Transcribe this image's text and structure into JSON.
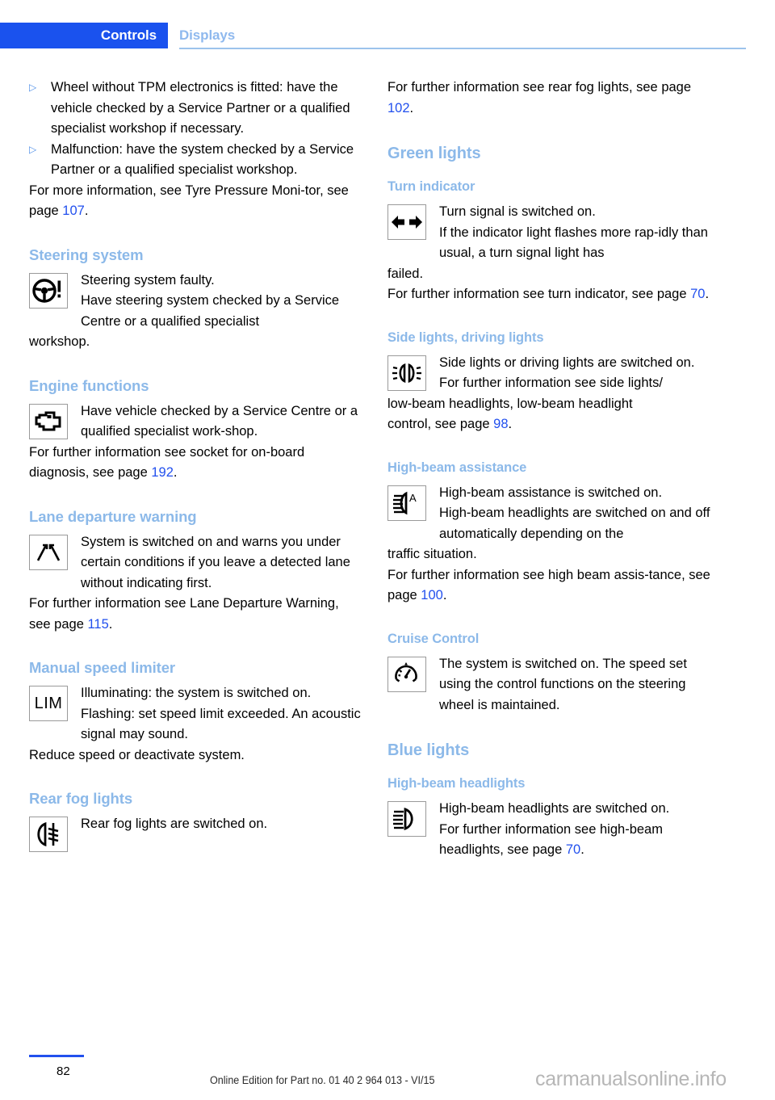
{
  "header": {
    "tab_active": "Controls",
    "tab_inactive": "Displays"
  },
  "colors": {
    "accent_blue": "#1A52EE",
    "heading_blue": "#8CB9E9",
    "link_blue": "#2250EE",
    "tab_inactive_blue": "#8FB9EE"
  },
  "left_column": {
    "bullets": [
      {
        "marker": "▷",
        "text": "Wheel without TPM electronics is fitted: have the vehicle checked by a Service Partner or a qualified specialist workshop if necessary."
      },
      {
        "marker": "▷",
        "text": "Malfunction: have the system checked by a Service Partner or a qualified specialist workshop."
      }
    ],
    "intro_para_prefix": "For more information, see Tyre Pressure Moni‐tor, see page ",
    "intro_para_link": "107",
    "intro_para_suffix": ".",
    "sections": [
      {
        "heading": "Steering system",
        "icon": "steering-wheel-warning-icon",
        "indented_lines": [
          "Steering system faulty.",
          "Have steering system checked by a Service Centre or a qualified specialist"
        ],
        "full_lines": [
          "workshop."
        ],
        "ref_prefix": "",
        "ref_link": "",
        "ref_suffix": ""
      },
      {
        "heading": "Engine functions",
        "icon": "engine-check-icon",
        "indented_lines": [
          "Have vehicle checked by a Service Centre or a qualified specialist work‐shop."
        ],
        "full_lines": [],
        "ref_prefix": "For further information see socket for on‐board diagnosis, see page ",
        "ref_link": "192",
        "ref_suffix": "."
      },
      {
        "heading": "Lane departure warning",
        "icon": "lane-departure-icon",
        "indented_lines": [
          "System is switched on and warns you under certain conditions if you leave a detected lane without indicating first."
        ],
        "full_lines": [],
        "ref_prefix": "For further information see Lane Departure Warning, see page ",
        "ref_link": "115",
        "ref_suffix": "."
      },
      {
        "heading": "Manual speed limiter",
        "icon": "lim-icon",
        "icon_label": "LIM",
        "indented_lines": [
          "Illuminating: the system is switched on.",
          "Flashing: set speed limit exceeded. An acoustic signal may sound."
        ],
        "full_lines": [
          "Reduce speed or deactivate system."
        ],
        "ref_prefix": "",
        "ref_link": "",
        "ref_suffix": ""
      },
      {
        "heading": "Rear fog lights",
        "icon": "rear-fog-light-icon",
        "indented_lines": [
          "Rear fog lights are switched on."
        ],
        "full_lines": [],
        "ref_prefix": "",
        "ref_link": "",
        "ref_suffix": ""
      }
    ]
  },
  "right_column": {
    "intro_prefix": "For further information see rear fog lights, see page ",
    "intro_link": "102",
    "intro_suffix": ".",
    "groups": [
      {
        "title": "Green lights",
        "sections": [
          {
            "heading": "Turn indicator",
            "icon": "turn-indicator-arrows-icon",
            "indented_lines": [
              "Turn signal is switched on.",
              "If the indicator light flashes more rap‐idly than usual, a turn signal light has"
            ],
            "full_lines": [
              "failed."
            ],
            "ref_prefix": "For further information see turn indicator, see page ",
            "ref_link": "70",
            "ref_suffix": "."
          },
          {
            "heading": "Side lights, driving lights",
            "icon": "side-lights-icon",
            "indented_lines": [
              "Side lights or driving lights are switched on.",
              "For further information see side lights/"
            ],
            "full_lines": [
              "low-beam headlights, low-beam headlight"
            ],
            "ref_prefix": "control, see page ",
            "ref_link": "98",
            "ref_suffix": "."
          },
          {
            "heading": "High-beam assistance",
            "icon": "high-beam-assist-icon",
            "indented_lines": [
              "High-beam assistance is switched on.",
              "High-beam headlights are switched on and off automatically depending on the"
            ],
            "full_lines": [
              "traffic situation."
            ],
            "ref_prefix": "For further information see high beam assis‐tance, see page ",
            "ref_link": "100",
            "ref_suffix": "."
          },
          {
            "heading": "Cruise Control",
            "icon": "cruise-control-speedometer-icon",
            "indented_lines": [
              "The system is switched on. The speed set using the control functions on the steering wheel is maintained."
            ],
            "full_lines": [],
            "ref_prefix": "",
            "ref_link": "",
            "ref_suffix": ""
          }
        ]
      },
      {
        "title": "Blue lights",
        "sections": [
          {
            "heading": "High-beam headlights",
            "icon": "high-beam-headlight-icon",
            "indented_lines": [
              "High-beam headlights are switched on.",
              "For further information see high-beam headlights, see page "
            ],
            "full_lines": [],
            "ref_prefix": "",
            "ref_link": "70",
            "ref_suffix": "."
          }
        ]
      }
    ]
  },
  "footer": {
    "page_number": "82",
    "edition_text": "Online Edition for Part no. 01 40 2 964 013 - VI/15",
    "watermark": "carmanualsonline.info"
  }
}
